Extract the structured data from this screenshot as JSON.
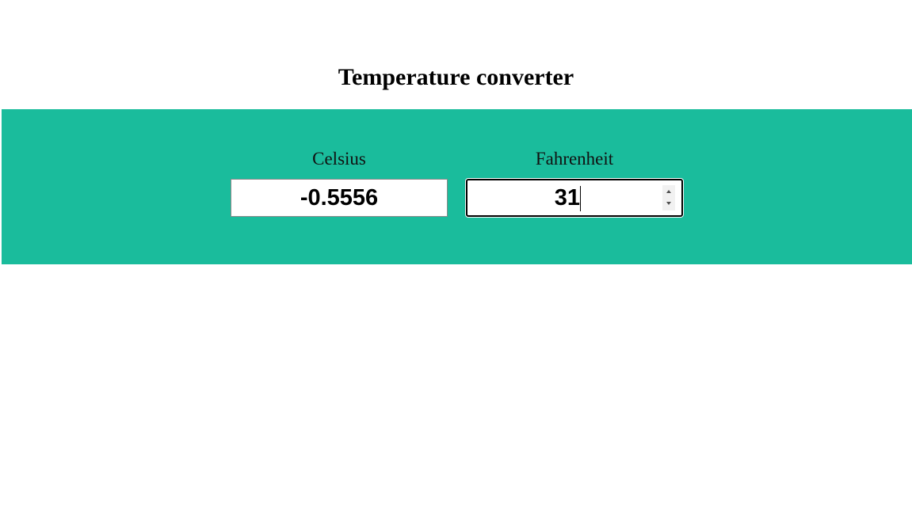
{
  "header": {
    "title": "Temperature converter"
  },
  "colors": {
    "band_background": "#1abc9c",
    "input_background": "#ffffff",
    "text": "#000000"
  },
  "converter": {
    "celsius": {
      "label": "Celsius",
      "value": "-0.5556"
    },
    "fahrenheit": {
      "label": "Fahrenheit",
      "value": "31",
      "focused": true
    }
  },
  "icons": {
    "spinner_up": "chevron-up-icon",
    "spinner_down": "chevron-down-icon"
  }
}
